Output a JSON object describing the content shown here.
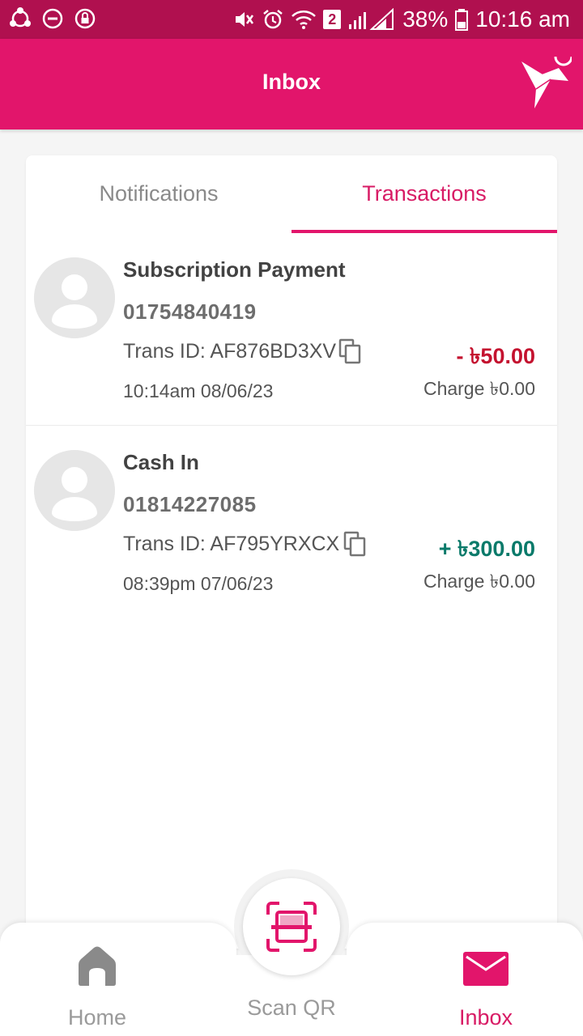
{
  "status_bar": {
    "battery": "38%",
    "time": "10:16 am",
    "sim_badge": "2"
  },
  "app_bar": {
    "title": "Inbox"
  },
  "tabs": [
    {
      "label": "Notifications",
      "active": false
    },
    {
      "label": "Transactions",
      "active": true
    }
  ],
  "transactions": [
    {
      "title": "Subscription Payment",
      "number": "01754840419",
      "trans_id": "Trans ID: AF876BD3XV",
      "time": "10:14am 08/06/23",
      "amount": "- ৳50.00",
      "charge": "Charge ৳0.00",
      "direction": "debit"
    },
    {
      "title": "Cash In",
      "number": "01814227085",
      "trans_id": "Trans ID: AF795YRXCX",
      "time": "08:39pm 07/06/23",
      "amount": "+ ৳300.00",
      "charge": "Charge ৳0.00",
      "direction": "credit"
    }
  ],
  "bottom_nav": {
    "home": "Home",
    "scan": "Scan QR",
    "inbox": "Inbox"
  },
  "colors": {
    "brand": "#e2156b",
    "status_bar": "#b0104f",
    "debit": "#c4122f",
    "credit": "#0a7a6a"
  },
  "icons": [
    "share-icon",
    "do-not-disturb-icon",
    "lock-icon",
    "mute-icon",
    "alarm-icon",
    "wifi-icon",
    "signal-icon",
    "battery-icon",
    "logo-icon",
    "avatar-icon",
    "copy-icon",
    "home-icon",
    "scan-qr-icon",
    "mail-icon"
  ]
}
